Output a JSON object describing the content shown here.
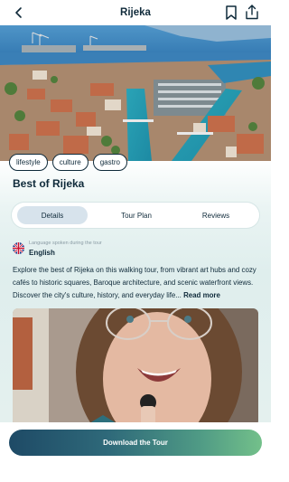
{
  "header": {
    "title": "Rijeka",
    "back_icon": "chevron-left-icon",
    "bookmark_icon": "bookmark-icon",
    "share_icon": "share-icon"
  },
  "hero": {
    "image": "aerial-city-harbor-photo"
  },
  "tags": [
    {
      "label": "lifestyle"
    },
    {
      "label": "culture"
    },
    {
      "label": "gastro"
    }
  ],
  "tour": {
    "title": "Best of Rijeka"
  },
  "tabs": [
    {
      "label": "Details",
      "active": true
    },
    {
      "label": "Tour Plan",
      "active": false
    },
    {
      "label": "Reviews",
      "active": false
    }
  ],
  "language": {
    "caption": "Language spoken during the tour",
    "value": "English",
    "flag_icon": "uk-flag-icon"
  },
  "description": {
    "text": "Explore the best of Rijeka on this walking tour, from vibrant art hubs and cozy cafés to historic squares, Baroque architecture, and scenic waterfront views. Discover the city's culture, history, and everyday life...",
    "more_label": "Read more"
  },
  "video": {
    "image": "guide-video-thumbnail"
  },
  "cta": {
    "label": "Download the Tour"
  },
  "colors": {
    "primary": "#0f2a3a",
    "accent_start": "#1e4a66",
    "accent_end": "#73c08a",
    "tab_active": "#d7e3ec"
  }
}
